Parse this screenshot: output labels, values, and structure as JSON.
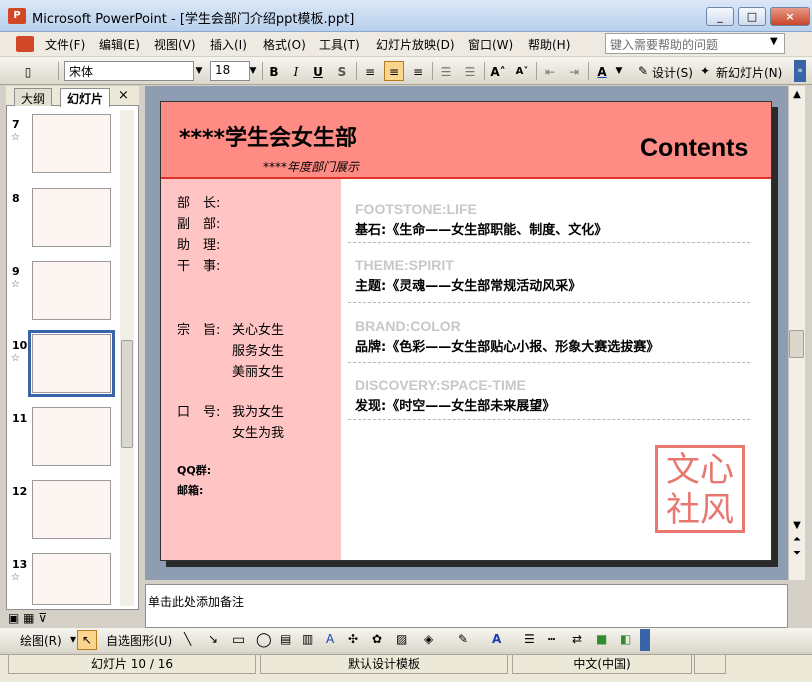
{
  "app": {
    "title": "Microsoft PowerPoint - [学生会部门介绍ppt模板.ppt]",
    "icon_glyph": "P",
    "window_controls": [
      "_",
      "□",
      "×"
    ]
  },
  "menu": {
    "items": [
      "文件(F)",
      "编辑(E)",
      "视图(V)",
      "插入(I)",
      "格式(O)",
      "工具(T)",
      "幻灯片放映(D)",
      "窗口(W)",
      "帮助(H)"
    ],
    "help_placeholder": "键入需要帮助的问题"
  },
  "toolbar": {
    "font_name": "宋体",
    "font_size": "18",
    "bold": "B",
    "italic": "I",
    "underline": "U",
    "shadow": "S",
    "design_label": "设计(S)",
    "new_slide_label": "新幻灯片(N)"
  },
  "panel": {
    "tabs": [
      "大纲",
      "幻灯片"
    ],
    "active_tab": "幻灯片",
    "close": "×",
    "slides": [
      {
        "num": "7",
        "star": true
      },
      {
        "num": "8",
        "star": false
      },
      {
        "num": "9",
        "star": true
      },
      {
        "num": "10",
        "star": true,
        "selected": true
      },
      {
        "num": "11",
        "star": false
      },
      {
        "num": "12",
        "star": false
      },
      {
        "num": "13",
        "star": true
      }
    ]
  },
  "slide": {
    "title": "****学生会女生部",
    "subtitle": "****年度部门展示",
    "contents": "Contents",
    "roles": [
      "部　长:",
      "副　部:",
      "助　理:",
      "干　事:"
    ],
    "purpose_label": "宗　旨:",
    "purpose_lines": [
      "关心女生",
      "服务女生",
      "美丽女生"
    ],
    "slogan_label": "口　号:",
    "slogan_lines": [
      "我为女生",
      "女生为我"
    ],
    "qq_label": "QQ群:",
    "email_label": "邮箱:",
    "sections": [
      {
        "en": "FOOTSTONE:LIFE",
        "cn": "基石:《生命——女生部职能、制度、文化》"
      },
      {
        "en": "THEME:SPIRIT",
        "cn": "主题:《灵魂——女生部常规活动风采》"
      },
      {
        "en": "BRAND:COLOR",
        "cn": "品牌:《色彩——女生部贴心小报、形象大赛选拔赛》"
      },
      {
        "en": "DISCOVERY:SPACE-TIME",
        "cn": "发现:《时空——女生部未来展望》"
      }
    ],
    "seal_chars": "文心社风"
  },
  "notes": {
    "placeholder": "单击此处添加备注"
  },
  "drawing": {
    "draw_label": "绘图(R)",
    "autoshape_label": "自选图形(U)"
  },
  "status": {
    "slide_pos": "幻灯片 10 / 16",
    "template": "默认设计模板",
    "language": "中文(中国)"
  }
}
